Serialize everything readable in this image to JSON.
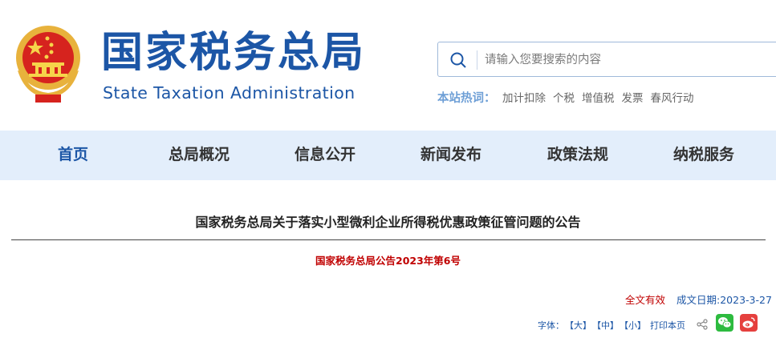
{
  "header": {
    "logo_cn": "国家税务总局",
    "logo_en": "State Taxation Administration",
    "search_placeholder": "请输入您要搜索的内容",
    "hot_label": "本站热词：",
    "hot_words": [
      "加计扣除",
      "个税",
      "增值税",
      "发票",
      "春风行动"
    ]
  },
  "nav": {
    "items": [
      "首页",
      "总局概况",
      "信息公开",
      "新闻发布",
      "政策法规",
      "纳税服务"
    ],
    "active_index": 0
  },
  "article": {
    "title": "国家税务总局关于落实小型微利企业所得税优惠政策征管问题的公告",
    "doc_number": "国家税务总局公告2023年第6号",
    "validity": "全文有效",
    "date_label": "成文日期:",
    "date_value": "2023-3-27"
  },
  "tools": {
    "font_label": "字体：",
    "size_large": "【大】",
    "size_medium": "【中】",
    "size_small": "【小】",
    "print": "打印本页"
  },
  "colors": {
    "brand_blue": "#1c56a6",
    "nav_bg": "#e3eefb",
    "red": "#c00000",
    "wechat_green": "#2dbb3f",
    "weibo_red": "#e5403e"
  }
}
